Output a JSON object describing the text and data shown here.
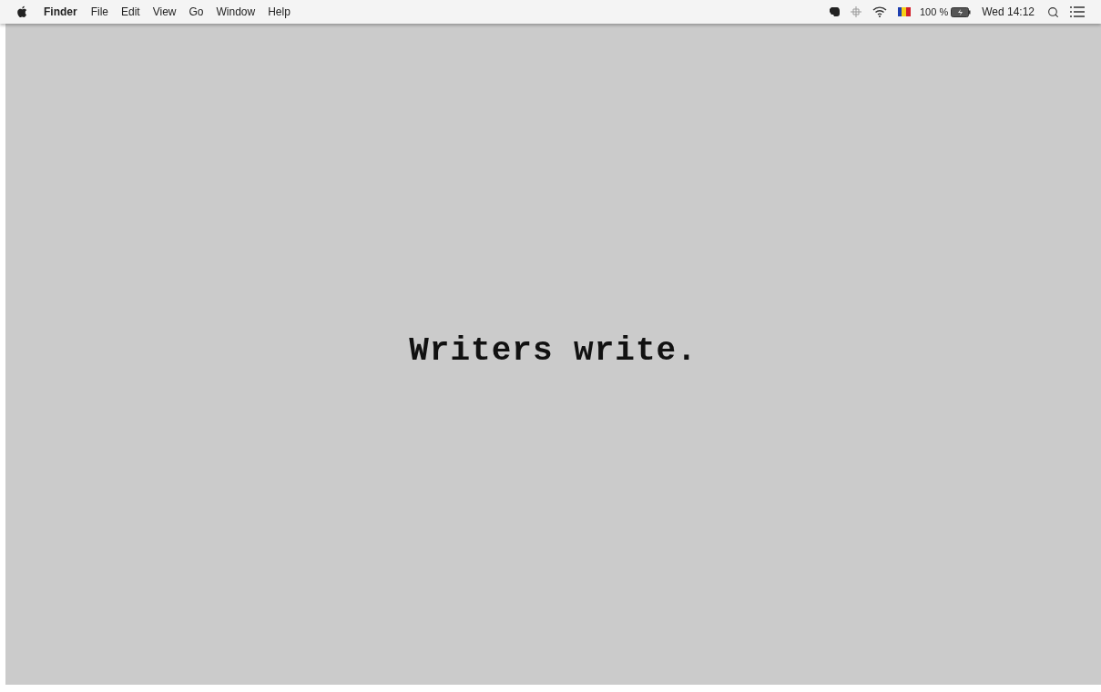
{
  "menu_bar": {
    "app_name": "Finder",
    "menus": [
      "File",
      "Edit",
      "View",
      "Go",
      "Window",
      "Help"
    ],
    "battery": "100 %",
    "clock": "Wed 14:12"
  },
  "desktop": {
    "text": "Writers write."
  }
}
